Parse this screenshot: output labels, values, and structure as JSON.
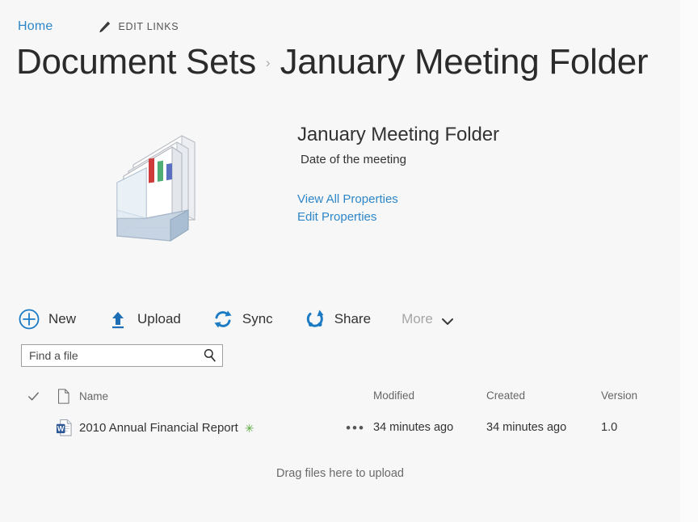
{
  "colors": {
    "background": "#f7f7f7",
    "link": "#2e86c8",
    "accent_blue": "#1d6fb5",
    "text": "#333333",
    "muted": "#a6a6a6",
    "new_badge_green": "#5aab3c",
    "search_border": "#a0a0a0"
  },
  "topbar": {
    "home_label": "Home",
    "edit_links_label": "EDIT LINKS",
    "pencil_icon": "pencil-icon"
  },
  "title": {
    "parent": "Document Sets",
    "separator": "›",
    "current": "January Meeting Folder"
  },
  "docset": {
    "icon": "document-set-icon",
    "name": "January Meeting Folder",
    "description": "Date of the meeting",
    "links": [
      {
        "label": "View All Properties",
        "name": "view-all-properties-link"
      },
      {
        "label": "Edit Properties",
        "name": "edit-properties-link"
      }
    ]
  },
  "commandbar": {
    "items": [
      {
        "label": "New",
        "icon": "plus-circle-icon",
        "name": "new-button"
      },
      {
        "label": "Upload",
        "icon": "upload-arrow-icon",
        "name": "upload-button"
      },
      {
        "label": "Sync",
        "icon": "sync-icon",
        "name": "sync-button"
      },
      {
        "label": "Share",
        "icon": "share-icon",
        "name": "share-button"
      },
      {
        "label": "More",
        "icon": "chevron-down-icon",
        "name": "more-button"
      }
    ]
  },
  "search": {
    "placeholder": "Find a file",
    "value": "",
    "icon": "search-icon"
  },
  "filelist": {
    "columns": {
      "check": "check-icon",
      "type": "document-icon",
      "name": "Name",
      "modified": "Modified",
      "created": "Created",
      "version": "Version"
    },
    "rows": [
      {
        "icon": "word-document-icon",
        "name": "2010 Annual Financial Report",
        "badge": "✳",
        "badge_name": "new-item-badge",
        "ellipsis": "•••",
        "modified": "34 minutes ago",
        "created": "34 minutes ago",
        "version": "1.0"
      }
    ],
    "drag_hint": "Drag files here to upload"
  }
}
